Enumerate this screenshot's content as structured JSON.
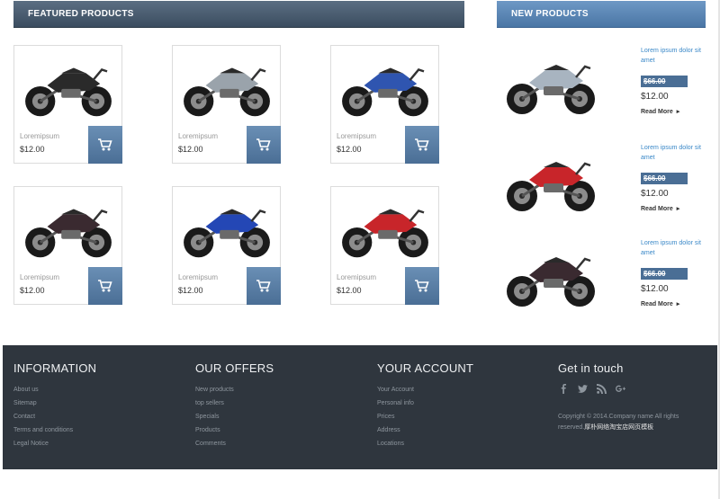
{
  "featured": {
    "title": "FEATURED PRODUCTS",
    "products": [
      {
        "name": "Loremipsum",
        "price": "$12.00",
        "color": "#2a2a2a"
      },
      {
        "name": "Loremipsum",
        "price": "$12.00",
        "color": "#9aa3ab"
      },
      {
        "name": "Loremipsum",
        "price": "$12.00",
        "color": "#2f55b0"
      },
      {
        "name": "Loremipsum",
        "price": "$12.00",
        "color": "#3a2a30"
      },
      {
        "name": "Loremipsum",
        "price": "$12.00",
        "color": "#2447b5"
      },
      {
        "name": "Loremipsum",
        "price": "$12.00",
        "color": "#c8252a"
      }
    ],
    "cart_icon": "shopping-cart-icon"
  },
  "new_products": {
    "title": "NEW PRODUCTS",
    "items": [
      {
        "title": "Lorem ipsum dolor sit amet",
        "old_price": "$66.00",
        "price": "$12.00",
        "more": "Read More",
        "color": "#a8b4c0"
      },
      {
        "title": "Lorem ipsum dolor sit amet",
        "old_price": "$66.00",
        "price": "$12.00",
        "more": "Read More",
        "color": "#c8252a"
      },
      {
        "title": "Lorem ipsum dolor sit amet",
        "old_price": "$66.00",
        "price": "$12.00",
        "more": "Read More",
        "color": "#3a2a30"
      }
    ]
  },
  "footer": {
    "information": {
      "title": "INFORMATION",
      "links": [
        "About us",
        "Sitemap",
        "Contact",
        "Terms and conditions",
        "Legal Notice"
      ]
    },
    "offers": {
      "title": "OUR OFFERS",
      "links": [
        "New products",
        "top sellers",
        "Specials",
        "Products",
        "Comments"
      ]
    },
    "account": {
      "title": "YOUR ACCOUNT",
      "links": [
        "Your Account",
        "Personal info",
        "Prices",
        "Address",
        "Locations"
      ]
    },
    "contact": {
      "title": "Get in touch",
      "social_icons": [
        "facebook-icon",
        "twitter-icon",
        "rss-icon",
        "google-plus-icon"
      ],
      "copyright": "Copyright © 2014.Company name All rights reserved.",
      "copyright_cn": "厚朴网络淘宝店网页模板"
    }
  }
}
